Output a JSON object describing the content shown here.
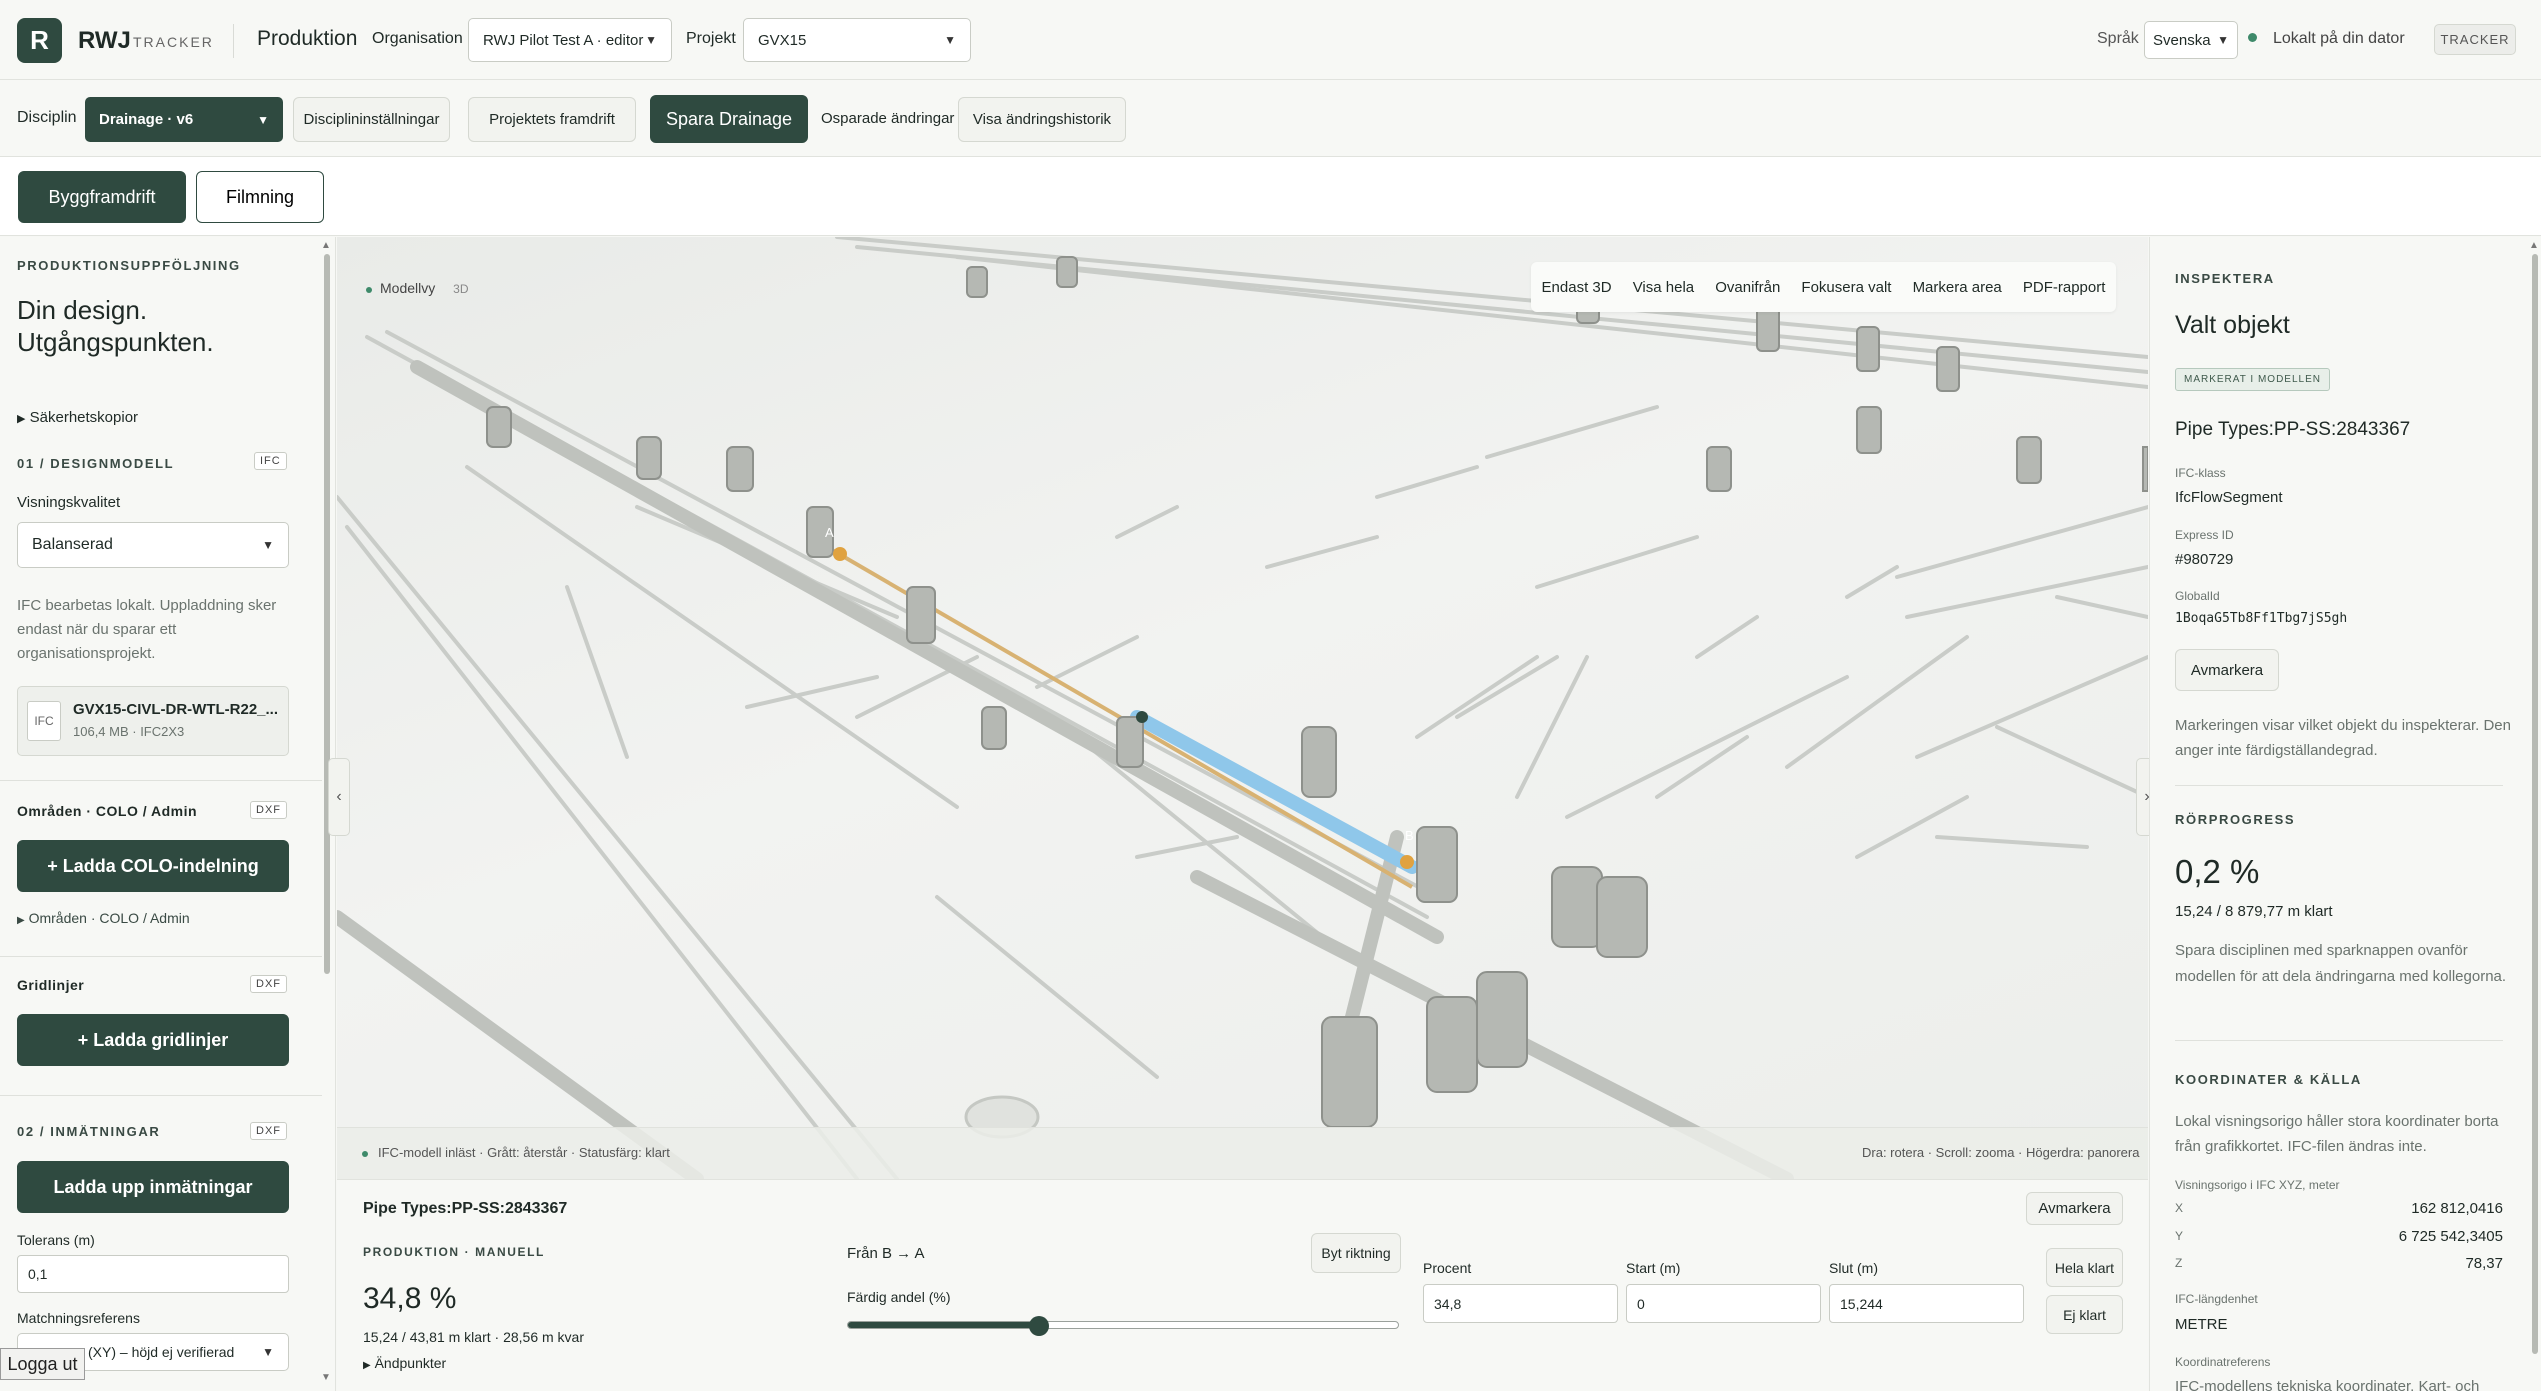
{
  "header": {
    "logo_letter": "R",
    "brand": "RWJ",
    "brand_sub": "TRACKER",
    "app_title": "Produktion",
    "org_label": "Organisation",
    "org_value": "RWJ Pilot Test A · editor",
    "project_label": "Projekt",
    "project_value": "GVX15",
    "lang_label": "Språk",
    "lang_value": "Svenska",
    "local_status": "Lokalt på din dator",
    "tracker_tag": "TRACKER"
  },
  "toolbar": {
    "discipline_label": "Disciplin",
    "discipline_value": "Drainage · v6",
    "discipline_settings": "Disciplininställningar",
    "project_progress": "Projektets framdrift",
    "save": "Spara Drainage",
    "unsaved": "Osparade ändringar",
    "history": "Visa ändringshistorik"
  },
  "mode_tabs": {
    "build": "Byggframdrift",
    "film": "Filmning"
  },
  "sidebar": {
    "section_label": "PRODUKTIONSUPPFÖLJNING",
    "headline_1": "Din design.",
    "headline_2": "Utgångspunkten.",
    "backups": "Säkerhetskopior",
    "design_model_label": "01 / DESIGNMODELL",
    "design_model_tag": "IFC",
    "quality_label": "Visningskvalitet",
    "quality_value": "Balanserad",
    "ifc_note": "IFC bearbetas lokalt. Uppladdning sker endast när du sparar ett organisationsprojekt.",
    "file_badge": "IFC",
    "file_name": "GVX15-CIVL-DR-WTL-R22_...",
    "file_meta": "106,4 MB · IFC2X3",
    "areas_label": "Områden · COLO / Admin",
    "areas_tag": "DXF",
    "load_colo": "+ Ladda COLO-indelning",
    "areas_toggle": "Områden · COLO / Admin",
    "grid_label": "Gridlinjer",
    "grid_tag": "DXF",
    "load_grid": "+ Ladda gridlinjer",
    "measure_label": "02 / INMÄTNINGAR",
    "measure_tag": "DXF",
    "upload_measure": "Ladda upp inmätningar",
    "tolerance_label": "Tolerans (m)",
    "tolerance_value": "0,1",
    "match_label": "Matchningsreferens",
    "match_value": "(XY) – höjd ej verifierad"
  },
  "viewport": {
    "model_view": "Modellvy",
    "model_view_tag": "3D",
    "tools": [
      "Endast 3D",
      "Visa hela",
      "Ovanifrån",
      "Fokusera valt",
      "Markera area",
      "PDF-rapport"
    ],
    "status_left": "IFC-modell inläst · Grått: återstår · Statusfärg: klart",
    "status_right": "Dra: rotera · Scroll: zooma · Högerdra: panorera",
    "marker_a": "A",
    "marker_b": "B"
  },
  "bottom": {
    "title": "Pipe Types:PP-SS:2843367",
    "unmark": "Avmarkera",
    "mode_label": "PRODUKTION · MANUELL",
    "percent": "34,8 %",
    "detail": "15,24 / 43,81 m klart · 28,56 m kvar",
    "endpoints": "Ändpunkter",
    "direction": "Från B → A",
    "switch_direction": "Byt riktning",
    "done_share_label": "Färdig andel (%)",
    "slider_fraction": 0.348,
    "percent_label": "Procent",
    "percent_value": "34,8",
    "start_label": "Start (m)",
    "start_value": "0",
    "end_label": "Slut (m)",
    "end_value": "15,244",
    "all_done": "Hela klart",
    "not_done": "Ej klart"
  },
  "inspect": {
    "section_label": "INSPEKTERA",
    "title": "Valt objekt",
    "badge": "MARKERAT I MODELLEN",
    "object_name": "Pipe Types:PP-SS:2843367",
    "ifc_class_label": "IFC-klass",
    "ifc_class_value": "IfcFlowSegment",
    "express_label": "Express ID",
    "express_value": "#980729",
    "globalid_label": "GlobalId",
    "globalid_value": "1BoqaG5Tb8Ff1Tbg7jS5gh",
    "unmark": "Avmarkera",
    "note": "Markeringen visar vilket objekt du inspekterar. Den anger inte färdigställandegrad.",
    "pipe_progress_label": "RÖRPROGRESS",
    "pipe_progress_value": "0,2 %",
    "pipe_progress_detail": "15,24 / 8 879,77 m klart",
    "save_note": "Spara disciplinen med sparknappen ovanför modellen för att dela ändringarna med kollegorna.",
    "coords_label": "KOORDINATER & KÄLLA",
    "coords_note": "Lokal visningsorigo håller stora koordinater borta från grafikkortet. IFC-filen ändras inte.",
    "origin_label": "Visningsorigo i IFC XYZ, meter",
    "x_label": "X",
    "x_value": "162 812,0416",
    "y_label": "Y",
    "y_value": "6 725 542,3405",
    "z_label": "Z",
    "z_value": "78,37",
    "unit_label": "IFC-längdenhet",
    "unit_value": "METRE",
    "coordref_label": "Koordinatreferens",
    "coordref_value": "IFC-modellens tekniska koordinater. Kart- och"
  },
  "logout": "Logga ut",
  "colors": {
    "accent": "#2f4a40",
    "status_green": "#3e8a6a",
    "selection_blue": "#8fc7ea",
    "marker_orange": "#e0a240"
  }
}
